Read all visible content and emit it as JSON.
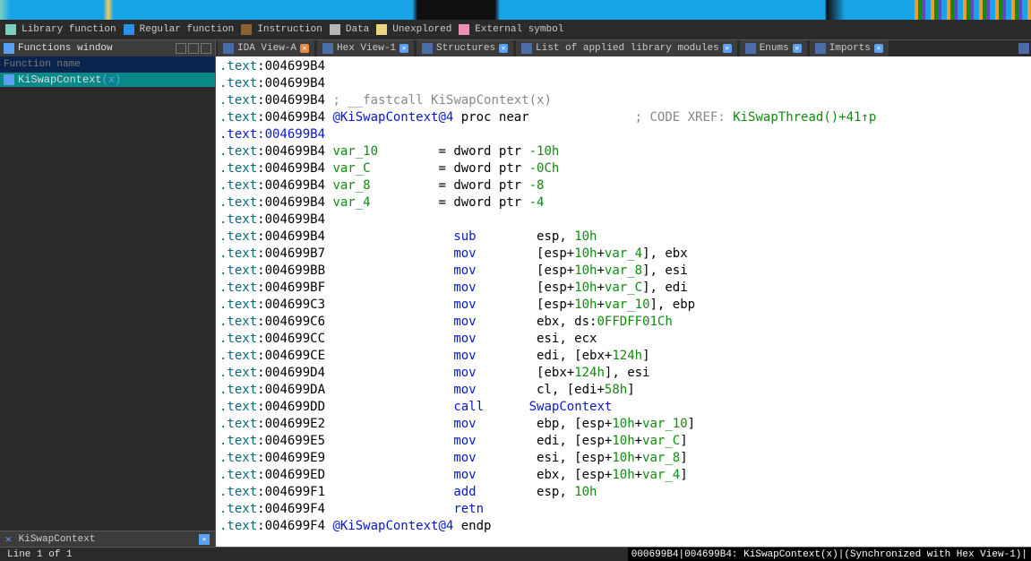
{
  "legend": {
    "library": "Library function",
    "regular": "Regular function",
    "instruction": "Instruction",
    "data": "Data",
    "unexplored": "Unexplored",
    "external": "External symbol"
  },
  "sidebar": {
    "title": "Functions window",
    "filter_placeholder": "Function name",
    "items": [
      {
        "name": "KiSwapContext",
        "args": "(x)"
      }
    ],
    "footer_label": "KiSwapContext"
  },
  "tabs": [
    {
      "label": "IDA View-A",
      "close": "red"
    },
    {
      "label": "Hex View-1",
      "close": "blue"
    },
    {
      "label": "Structures",
      "close": "blue"
    },
    {
      "label": "List of applied library modules",
      "close": "blue"
    },
    {
      "label": "Enums",
      "close": "blue"
    },
    {
      "label": "Imports",
      "close": "blue"
    }
  ],
  "disasm": {
    "segment": ".text",
    "addr": "004699B4",
    "comment_sig": "; __fastcall KiSwapContext(x)",
    "proc_name": "@KiSwapContext@4",
    "proc_kw": " proc near",
    "xref_label": "; CODE XREF: ",
    "xref_target": "KiSwapThread()+41↑p",
    "vars": [
      {
        "name": "var_10",
        "def_pre": "= dword ptr ",
        "def_val": "-10h"
      },
      {
        "name": "var_C",
        "def_pre": "= dword ptr ",
        "def_val": "-0Ch"
      },
      {
        "name": "var_8",
        "def_pre": "= dword ptr ",
        "def_val": "-8"
      },
      {
        "name": "var_4",
        "def_pre": "= dword ptr ",
        "def_val": "-4"
      }
    ],
    "body": [
      {
        "a": "004699B4",
        "op": "sub",
        "arg": "    esp, 10h",
        "num": "10h"
      },
      {
        "a": "004699B7",
        "op": "mov",
        "arg": "    [esp+10h+var_4], ebx",
        "var": "var_4",
        "num": "10h"
      },
      {
        "a": "004699BB",
        "op": "mov",
        "arg": "    [esp+10h+var_8], esi",
        "var": "var_8",
        "num": "10h"
      },
      {
        "a": "004699BF",
        "op": "mov",
        "arg": "    [esp+10h+var_C], edi",
        "var": "var_C",
        "num": "10h"
      },
      {
        "a": "004699C3",
        "op": "mov",
        "arg": "    [esp+10h+var_10], ebp",
        "var": "var_10",
        "num": "10h"
      },
      {
        "a": "004699C6",
        "op": "mov",
        "arg": "    ebx, ds:0FFDFF01Ch",
        "num": "0FFDFF01Ch"
      },
      {
        "a": "004699CC",
        "op": "mov",
        "arg": "    esi, ecx"
      },
      {
        "a": "004699CE",
        "op": "mov",
        "arg": "    edi, [ebx+124h]",
        "num": "124h"
      },
      {
        "a": "004699D4",
        "op": "mov",
        "arg": "    [ebx+124h], esi",
        "num": "124h"
      },
      {
        "a": "004699DA",
        "op": "mov",
        "arg": "    cl, [edi+58h]",
        "num": "58h"
      },
      {
        "a": "004699DD",
        "op": "call",
        "call": "SwapContext"
      },
      {
        "a": "004699E2",
        "op": "mov",
        "arg": "    ebp, [esp+10h+var_10]",
        "var": "var_10",
        "num": "10h"
      },
      {
        "a": "004699E5",
        "op": "mov",
        "arg": "    edi, [esp+10h+var_C]",
        "var": "var_C",
        "num": "10h"
      },
      {
        "a": "004699E9",
        "op": "mov",
        "arg": "    esi, [esp+10h+var_8]",
        "var": "var_8",
        "num": "10h"
      },
      {
        "a": "004699ED",
        "op": "mov",
        "arg": "    ebx, [esp+10h+var_4]",
        "var": "var_4",
        "num": "10h"
      },
      {
        "a": "004699F1",
        "op": "add",
        "arg": "    esp, 10h",
        "num": "10h"
      },
      {
        "a": "004699F4",
        "op": "retn"
      }
    ],
    "end_addr": "004699F4",
    "end_name": "@KiSwapContext@4",
    "end_kw": " endp"
  },
  "status": {
    "left": "Line 1 of 1",
    "right": "000699B4|004699B4: KiSwapContext(x)|(Synchronized with Hex View-1)|"
  }
}
